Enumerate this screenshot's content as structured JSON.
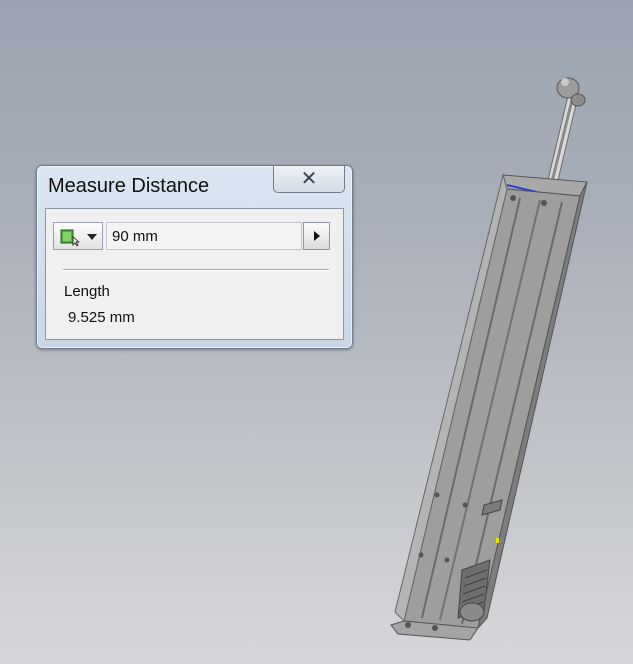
{
  "dialog": {
    "title": "Measure Distance",
    "close_label": "✕",
    "selection_mode_icon": "select-priority-icon",
    "value_field": "90 mm",
    "result_label": "Length",
    "result_value": "9.525 mm"
  },
  "viewport": {
    "model": "linear-actuator-icon"
  },
  "colors": {
    "highlight_edge": "#2a3fd8",
    "dialog_background": "#f0f0f0",
    "viewport_top": "#9ba3b0",
    "viewport_bottom": "#d6d7da"
  }
}
